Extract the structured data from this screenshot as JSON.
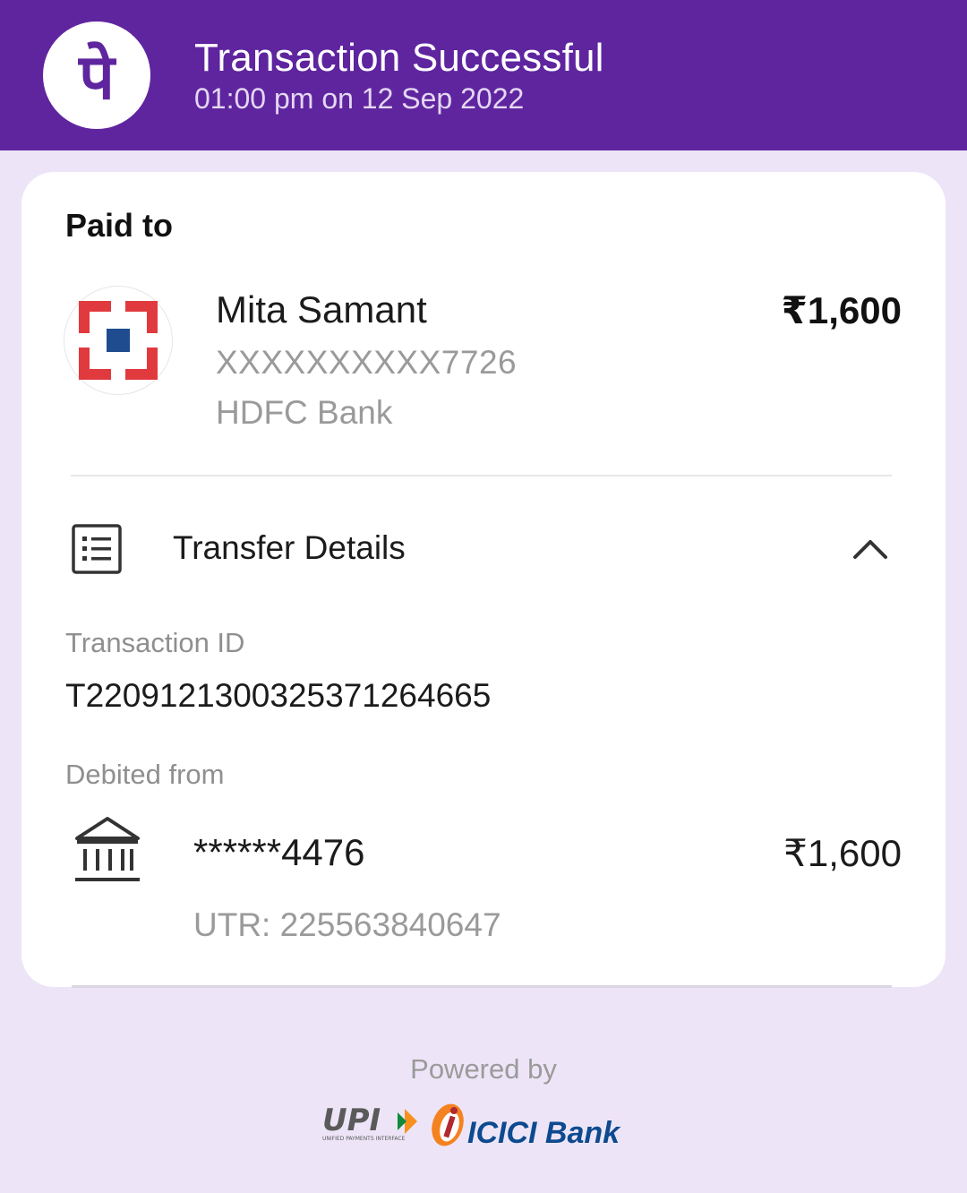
{
  "header": {
    "status_title": "Transaction Successful",
    "timestamp": "01:00 pm on 12 Sep 2022",
    "app_logo_glyph": "पे",
    "brand_color": "#5f259f"
  },
  "paid_to": {
    "section_label": "Paid to",
    "name": "Mita Samant",
    "account": "XXXXXXXXXX7726",
    "bank": "HDFC Bank",
    "amount": "₹1,600",
    "bank_logo_icon": "hdfc-bank-logo"
  },
  "transfer_details": {
    "label": "Transfer Details",
    "icon": "receipt-list-icon",
    "toggle_icon": "chevron-up-icon",
    "transaction_id_label": "Transaction ID",
    "transaction_id": "T2209121300325371264665",
    "debited_from_label": "Debited from",
    "debit_account": "******4476",
    "debit_amount": "₹1,600",
    "utr": "UTR: 225563840647",
    "debit_icon": "bank-building-icon"
  },
  "footer": {
    "powered_by": "Powered by",
    "upi_logo_text": "UPI",
    "upi_tagline": "UNIFIED PAYMENTS INTERFACE",
    "icici_logo_text": "ICICI Bank"
  }
}
